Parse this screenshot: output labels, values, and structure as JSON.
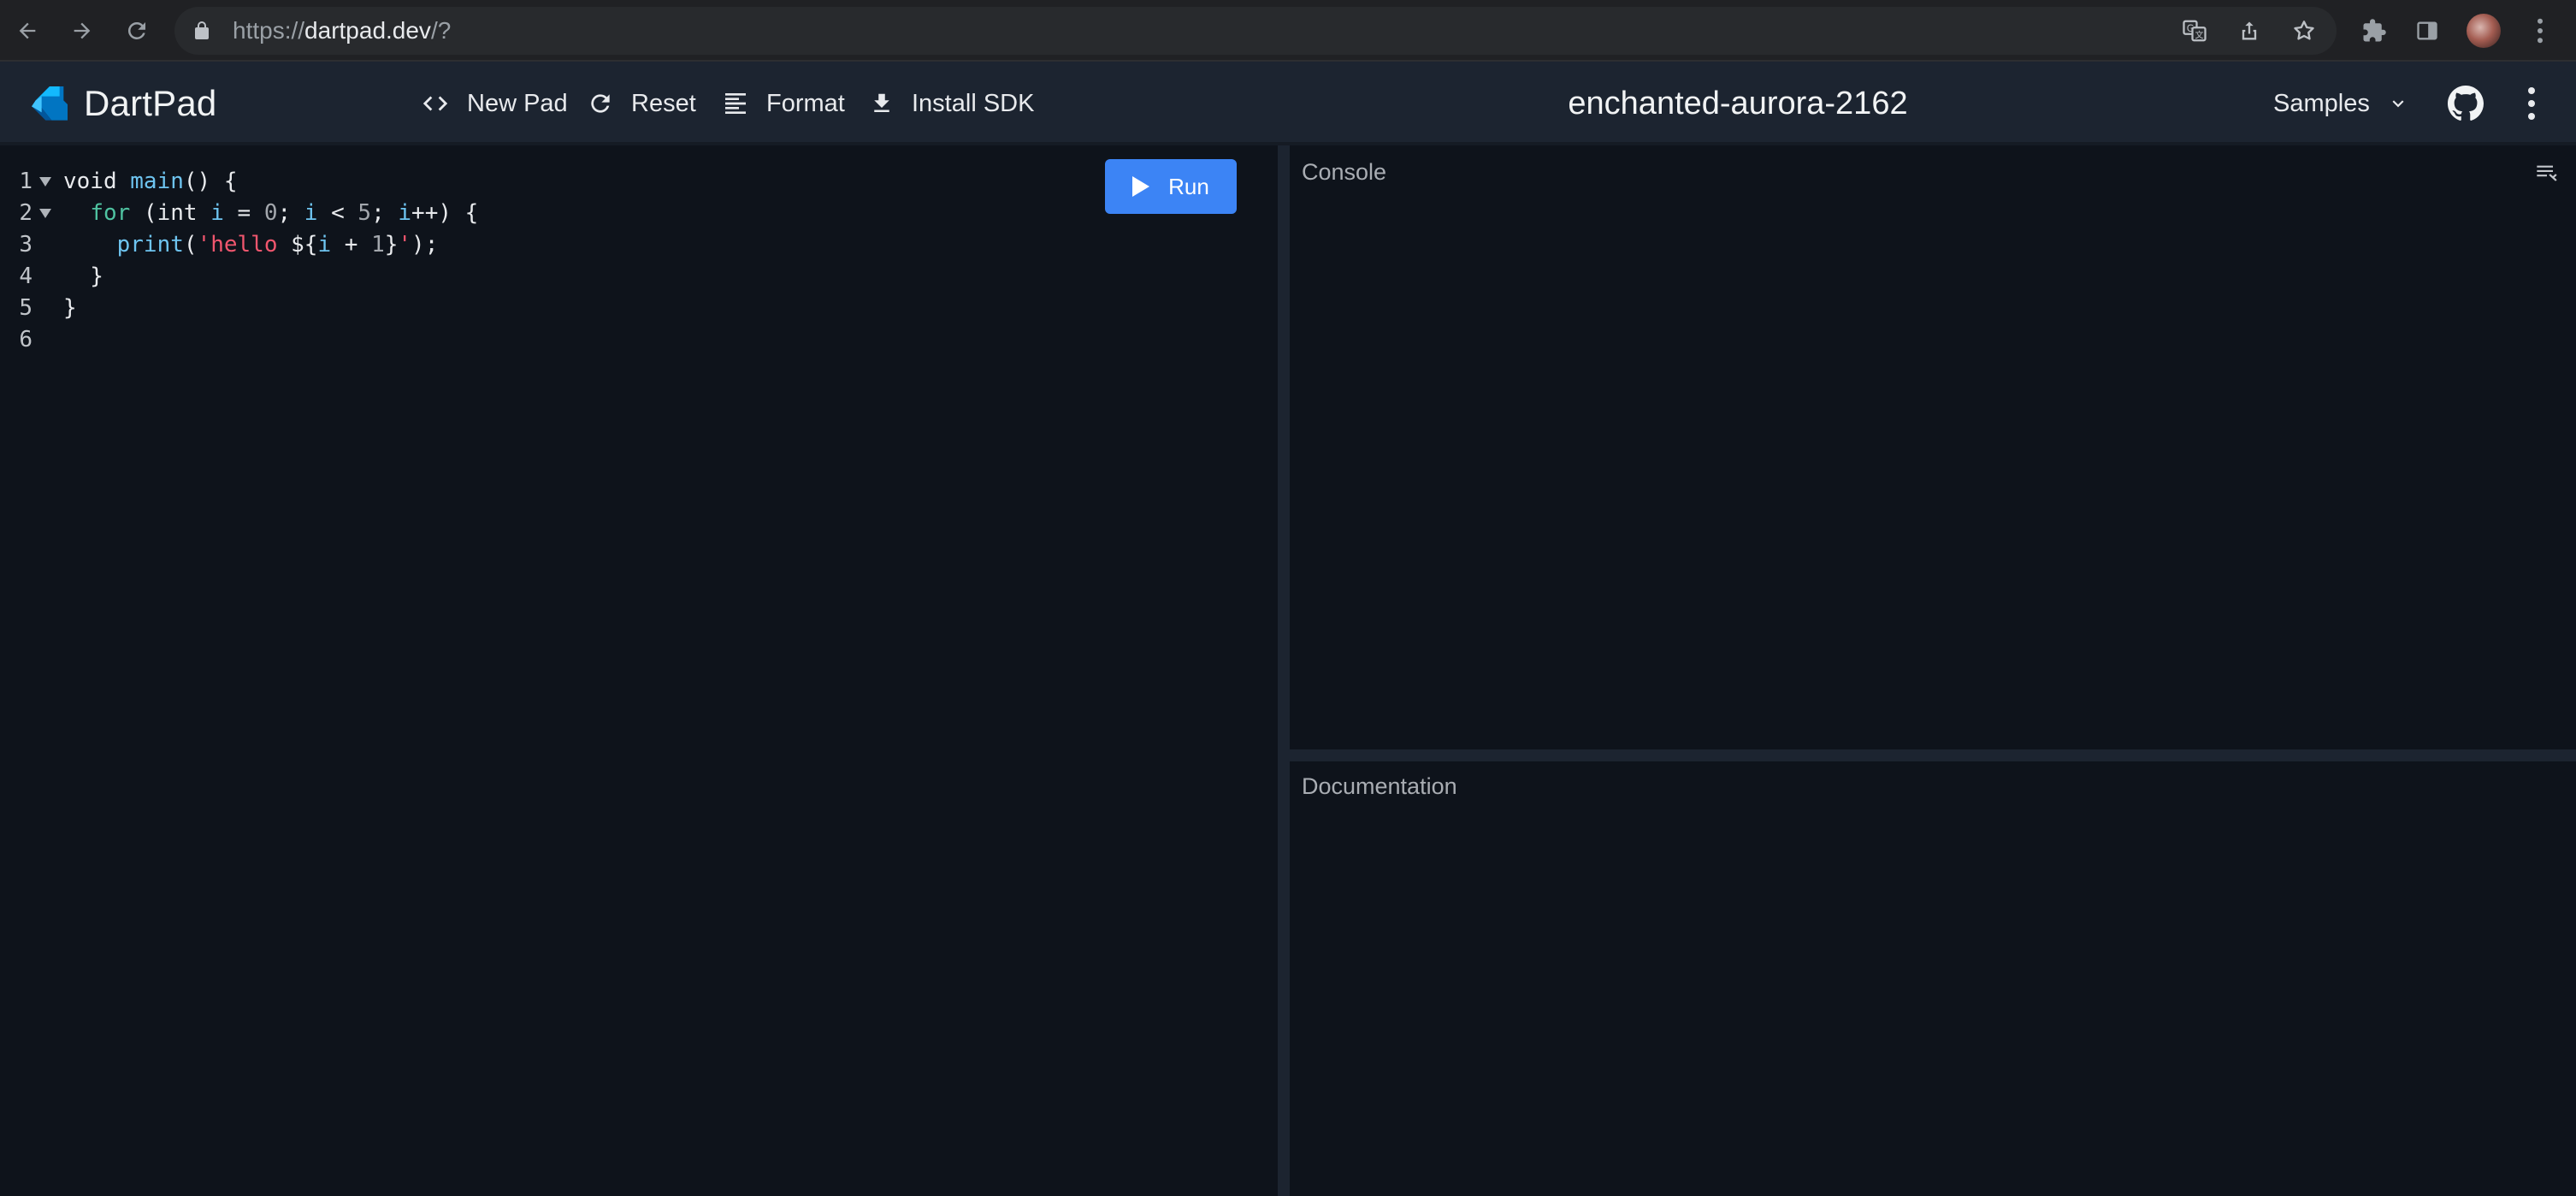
{
  "browser": {
    "url_scheme": "https://",
    "url_host": "dartpad.dev",
    "url_path": "/?",
    "icons": [
      "back-icon",
      "forward-icon",
      "reload-icon",
      "lock-icon",
      "translate-icon",
      "share-icon",
      "bookmark-star-icon",
      "extensions-icon",
      "side-panel-icon",
      "profile-avatar",
      "chrome-menu-icon"
    ]
  },
  "header": {
    "brand": "DartPad",
    "toolbar": {
      "new_pad": "New Pad",
      "reset": "Reset",
      "format": "Format",
      "install_sdk": "Install SDK"
    },
    "pad_title": "enchanted-aurora-2162",
    "samples": "Samples"
  },
  "editor": {
    "line_numbers": [
      "1",
      "2",
      "3",
      "4",
      "5",
      "6"
    ],
    "run_label": "Run",
    "code_lines": [
      "void main() {",
      "  for (int i = 0; i < 5; i++) {",
      "    print('hello ${i + 1}');",
      "  }",
      "}",
      ""
    ]
  },
  "panels": {
    "console_label": "Console",
    "documentation_label": "Documentation"
  },
  "colors": {
    "background": "#0e131b",
    "header": "#1c2430",
    "run_button": "#3c84f5",
    "keyword": "#4fc3a1",
    "identifier": "#6ec4f0",
    "string": "#f0566e",
    "number": "#a3a7ad"
  }
}
